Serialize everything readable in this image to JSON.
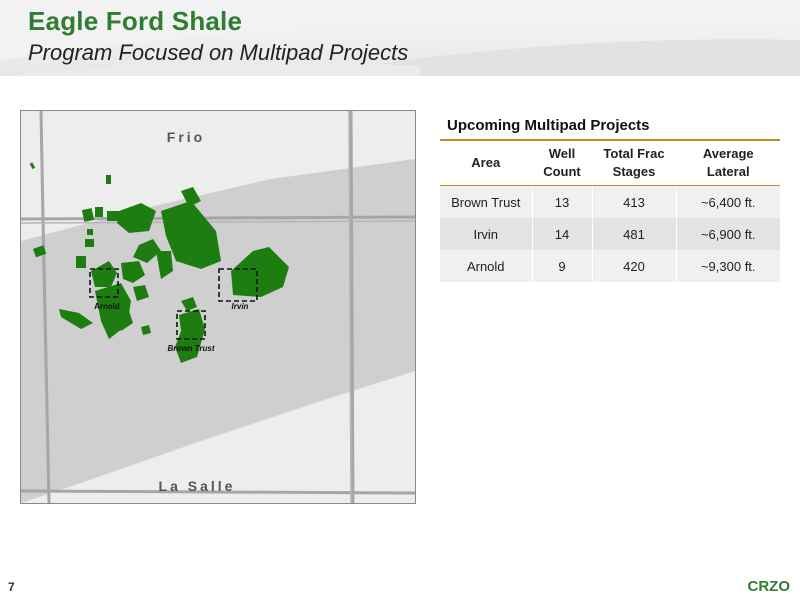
{
  "header": {
    "title": "Eagle Ford Shale",
    "subtitle": "Program Focused on Multipad Projects"
  },
  "map": {
    "county_labels": {
      "north": "Frio",
      "south": "La Salle"
    },
    "project_labels": {
      "arnold": "Arnold",
      "irvin": "Irvin",
      "brown_trust": "Brown Trust"
    },
    "colors": {
      "acreage": "#1e7d10",
      "trend_band": "#cfcfcf",
      "background": "#ededed",
      "roads": "#a6a6a6"
    }
  },
  "table": {
    "title": "Upcoming Multipad Projects",
    "headers": {
      "area": "Area",
      "well_count_1": "Well",
      "well_count_2": "Count",
      "frac_stages_1": "Total Frac",
      "frac_stages_2": "Stages",
      "lateral_1": "Average",
      "lateral_2": "Lateral"
    },
    "rows": [
      {
        "area": "Brown Trust",
        "wells": "13",
        "stages": "413",
        "lateral": "~6,400 ft."
      },
      {
        "area": "Irvin",
        "wells": "14",
        "stages": "481",
        "lateral": "~6,900 ft."
      },
      {
        "area": "Arnold",
        "wells": "9",
        "stages": "420",
        "lateral": "~9,300 ft."
      }
    ]
  },
  "footer": {
    "page_number": "7",
    "logo": "CRZO"
  },
  "colors": {
    "title_green": "#2e7d32",
    "rule_orange": "#c98a1e",
    "alt_row": "#f0f0f0"
  }
}
